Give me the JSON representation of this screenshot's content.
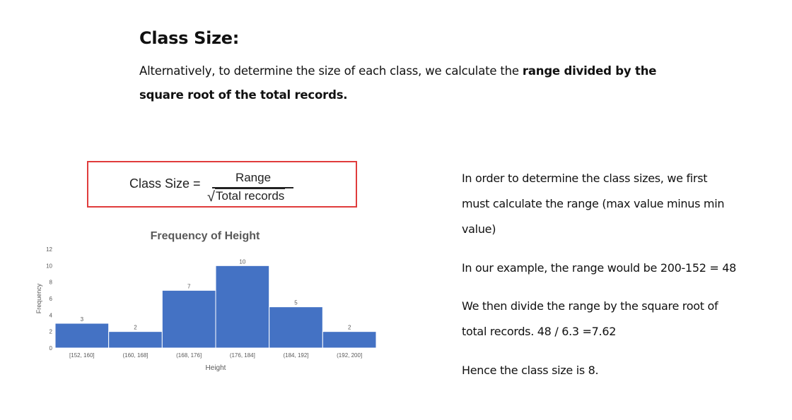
{
  "heading": "Class Size:",
  "intro": {
    "text": "Alternatively, to determine the size of each class,  we calculate the ",
    "bold_line1": "range divided by the",
    "bold_line2": "square root of the total records."
  },
  "formula": {
    "lhs": "Class Size =",
    "numerator": "Range",
    "denominator": "Total records"
  },
  "chart_data": {
    "type": "bar",
    "title": "Frequency of Height",
    "xlabel": "Height",
    "ylabel": "Frequency",
    "categories": [
      "[152, 160]",
      "(160, 168]",
      "(168, 176]",
      "(176, 184]",
      "(184, 192]",
      "(192, 200]"
    ],
    "values": [
      3,
      2,
      7,
      10,
      5,
      2
    ],
    "ylim": [
      0,
      12
    ],
    "yticks": [
      0,
      2,
      4,
      6,
      8,
      10,
      12
    ],
    "grid": false,
    "bar_color": "#4472c4",
    "tick_label_color": "#595959",
    "axis_title_color": "#595959"
  },
  "explanation": {
    "p1_line1": "In order to determine the class sizes, we first",
    "p1_line2": "must calculate the range (max value minus min",
    "p1_line3": "value)",
    "p2": "In our example, the range would be 200-152 = 48",
    "p3_line1": "We then divide the range by the square root of",
    "p3_line2": "total records.  48 / 6.3 =7.62",
    "p4": "Hence the class size is 8."
  },
  "colors": {
    "formula_border": "#e03c3c",
    "text": "#111111"
  }
}
